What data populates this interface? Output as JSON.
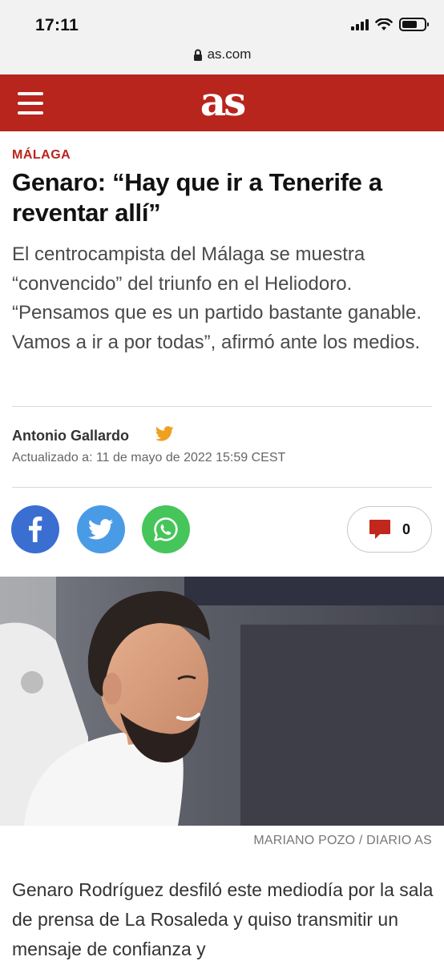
{
  "status_bar": {
    "time": "17:11"
  },
  "browser": {
    "url": "as.com"
  },
  "header": {
    "logo_text": "as",
    "brand_color": "#b8251d"
  },
  "article": {
    "section": "MÁLAGA",
    "headline": "Genaro: “Hay que ir a Tenerife a reventar allí”",
    "subtitle": "El centrocampista del Málaga se muestra “convencido” del triunfo en el Heliodoro. “Pensamos que es un partido bastante ganable. Vamos a ir a por todas”, afirmó ante los medios.",
    "author": "Antonio Gallardo",
    "updated": "Actualizado a: 11 de mayo de 2022 15:59 CEST",
    "comments_count": "0",
    "photo_credit": "MARIANO POZO  / DIARIO AS",
    "body": "Genaro Rodríguez desfiló este mediodía por la sala de prensa de La Rosaleda y quiso transmitir un mensaje de confianza y"
  },
  "icons": {
    "menu": "hamburger-icon",
    "lock": "lock-icon",
    "author_twitter": "twitter-icon",
    "share": [
      "facebook-icon",
      "twitter-icon",
      "whatsapp-icon"
    ],
    "comments": "comment-bubble-icon"
  },
  "colors": {
    "facebook": "#3b6ed1",
    "twitter": "#4a9be6",
    "whatsapp": "#46c55a",
    "author_twitter": "#f0a020"
  }
}
